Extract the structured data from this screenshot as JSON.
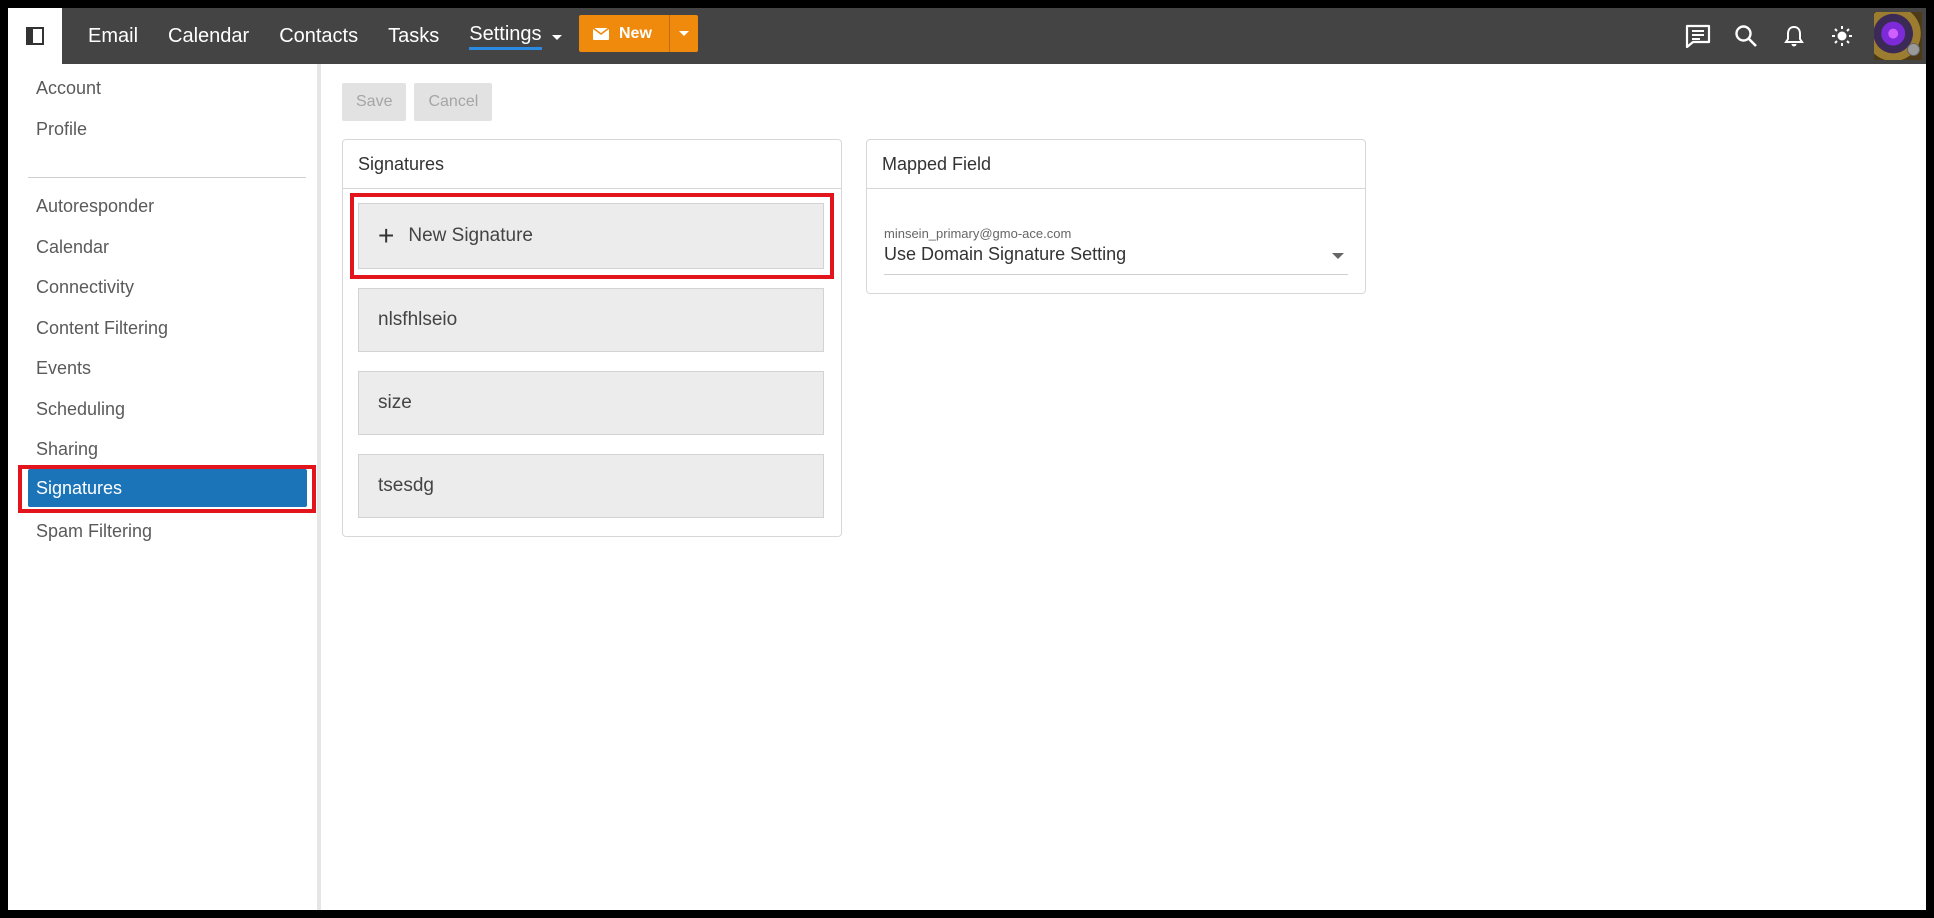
{
  "topbar": {
    "nav": [
      "Email",
      "Calendar",
      "Contacts",
      "Tasks",
      "Settings"
    ],
    "new_button": "New",
    "icons": [
      "chat-icon",
      "search-icon",
      "bell-icon",
      "brightness-icon"
    ]
  },
  "sidebar": {
    "items": [
      "Account",
      "Profile",
      "Autoresponder",
      "Calendar",
      "Connectivity",
      "Content Filtering",
      "Events",
      "Scheduling",
      "Sharing",
      "Signatures",
      "Spam Filtering"
    ],
    "selected": "Signatures"
  },
  "toolbar": {
    "save": "Save",
    "cancel": "Cancel"
  },
  "signatures_panel": {
    "title": "Signatures",
    "new_label": "New Signature",
    "items": [
      "nlsfhlseio",
      "size",
      "tsesdg"
    ]
  },
  "mapped_panel": {
    "title": "Mapped Field",
    "field_label": "minsein_primary@gmo-ace.com",
    "field_value": "Use Domain Signature Setting"
  },
  "colors": {
    "accent": "#1b74b8",
    "new_button": "#f08a0c",
    "highlight": "#e1151b",
    "topbar": "#444444"
  }
}
